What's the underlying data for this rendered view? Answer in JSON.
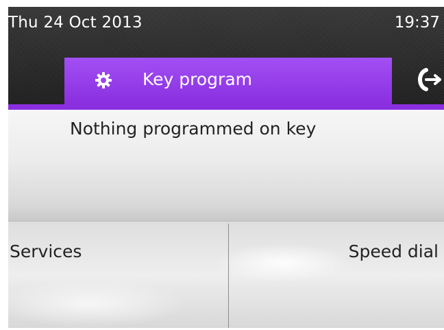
{
  "status_bar": {
    "date": "Thu 24 Oct 2013",
    "time": "19:37"
  },
  "tabs": {
    "active": {
      "label": "Key program",
      "icon": "gear-icon",
      "color": "#9b44f0"
    },
    "next": {
      "icon": "call-forward-icon"
    }
  },
  "message": {
    "text": "Nothing programmed on key"
  },
  "softkeys": {
    "left_label": "Services",
    "right_label": "Speed dial"
  },
  "colors": {
    "accent": "#8a2fe0",
    "header_bg": "#2b2b2b",
    "text_dark": "#222222"
  }
}
